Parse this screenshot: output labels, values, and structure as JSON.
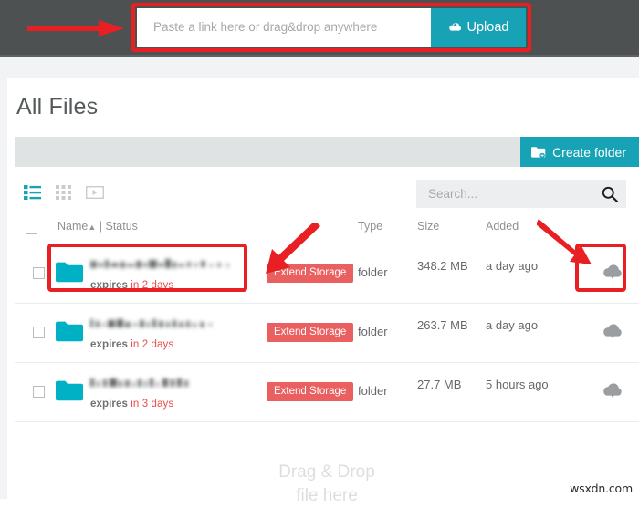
{
  "topbar": {
    "upload_placeholder": "Paste a link here or drag&drop anywhere",
    "upload_value": "",
    "upload_button_label": "Upload",
    "upload_icon": "cloud-upload-icon",
    "bar_color": "#4d5152",
    "accent_color": "#17a2b5"
  },
  "annotations": {
    "color": "#e81f23",
    "arrow_top_left": "right-arrow",
    "arrow_extend_storage": "down-left-arrow",
    "arrow_download": "down-right-arrow",
    "box_upload": true,
    "box_first_row_name": true,
    "box_first_row_download": true
  },
  "page": {
    "title": "All Files",
    "create_folder_label": "Create folder",
    "create_folder_icon": "folder-plus-icon"
  },
  "toolbar": {
    "views": [
      {
        "name": "list-view-icon",
        "label": "List view",
        "active": true
      },
      {
        "name": "grid-view-icon",
        "label": "Grid view",
        "active": false
      },
      {
        "name": "media-view-icon",
        "label": "Media view",
        "active": false
      }
    ],
    "search": {
      "placeholder": "Search...",
      "value": "",
      "icon": "search-icon"
    }
  },
  "table": {
    "columns": {
      "select_all": "",
      "name": "Name",
      "sort_indicator": "▲",
      "separator": "|",
      "status": "Status",
      "type": "Type",
      "size": "Size",
      "added": "Added"
    },
    "rows": [
      {
        "name": "",
        "name_redacted": true,
        "expires_label": "expires",
        "expires_when": "in 2 days",
        "action_label": "Extend Storage",
        "type": "folder",
        "size": "348.2 MB",
        "added": "a day ago",
        "download_icon": "cloud-download-icon",
        "selected": false
      },
      {
        "name": "",
        "name_redacted": true,
        "expires_label": "expires",
        "expires_when": "in 2 days",
        "action_label": "Extend Storage",
        "type": "folder",
        "size": "263.7 MB",
        "added": "a day ago",
        "download_icon": "cloud-download-icon",
        "selected": false
      },
      {
        "name": "",
        "name_redacted": true,
        "expires_label": "expires",
        "expires_when": "in 3 days",
        "action_label": "Extend Storage",
        "type": "folder",
        "size": "27.7 MB",
        "added": "5 hours ago",
        "download_icon": "cloud-download-icon",
        "selected": false
      }
    ]
  },
  "dropzone": {
    "line1": "Drag & Drop",
    "line2": "file here"
  },
  "watermark": {
    "text": "wsxdn.com"
  },
  "colors": {
    "teal": "#17a2b5",
    "red_badge": "#ea5f60",
    "expire_red": "#ea4c4c",
    "annotation_red": "#e81f23",
    "folder_teal": "#00b0c4",
    "strip_gray": "#dfe3e4"
  }
}
